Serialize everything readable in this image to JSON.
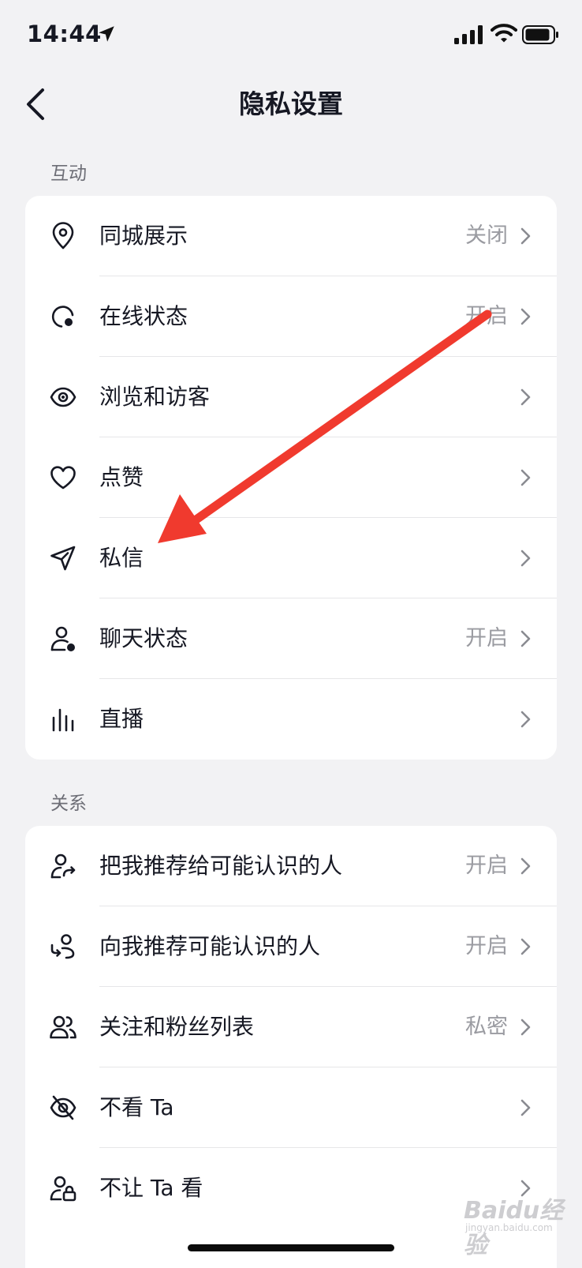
{
  "status_bar": {
    "time": "14:44"
  },
  "nav": {
    "title": "隐私设置"
  },
  "sections": [
    {
      "label": "互动",
      "items": [
        {
          "label": "同城展示",
          "value": "关闭",
          "icon": "location-pin-icon"
        },
        {
          "label": "在线状态",
          "value": "开启",
          "icon": "online-status-icon"
        },
        {
          "label": "浏览和访客",
          "value": "",
          "icon": "eye-icon"
        },
        {
          "label": "点赞",
          "value": "",
          "icon": "heart-icon"
        },
        {
          "label": "私信",
          "value": "",
          "icon": "paper-plane-icon"
        },
        {
          "label": "聊天状态",
          "value": "开启",
          "icon": "user-status-icon"
        },
        {
          "label": "直播",
          "value": "",
          "icon": "bars-icon"
        }
      ]
    },
    {
      "label": "关系",
      "items": [
        {
          "label": "把我推荐给可能认识的人",
          "value": "开启",
          "icon": "user-share-icon"
        },
        {
          "label": "向我推荐可能认识的人",
          "value": "开启",
          "icon": "user-recommend-icon"
        },
        {
          "label": "关注和粉丝列表",
          "value": "私密",
          "icon": "users-icon"
        },
        {
          "label": "不看 Ta",
          "value": "",
          "icon": "eye-off-icon"
        },
        {
          "label": "不让 Ta 看",
          "value": "",
          "icon": "user-lock-icon"
        }
      ]
    }
  ],
  "watermark": {
    "main": "Baidu经验",
    "sub": "jingyan.baidu.com"
  },
  "colors": {
    "background": "#f2f2f4",
    "card": "#ffffff",
    "text": "#161823",
    "secondary": "#9a9ba1",
    "annotation": "#f03a2e"
  }
}
